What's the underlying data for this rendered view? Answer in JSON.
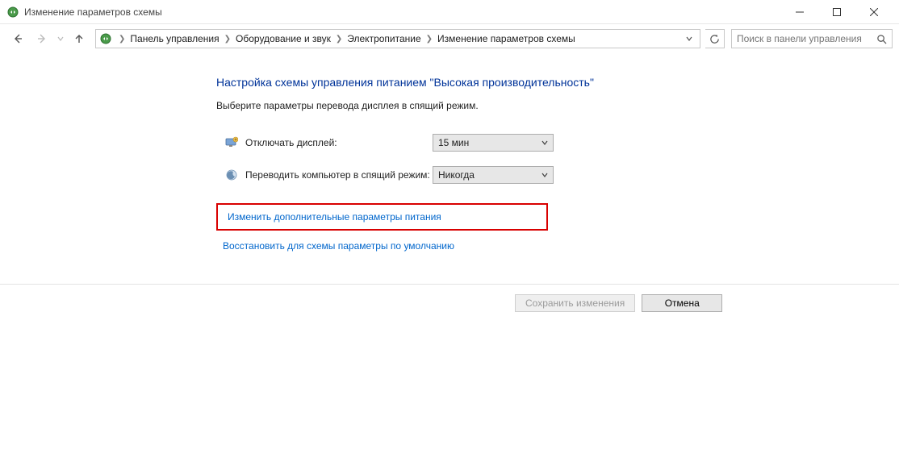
{
  "window": {
    "title": "Изменение параметров схемы"
  },
  "breadcrumb": {
    "items": [
      "Панель управления",
      "Оборудование и звук",
      "Электропитание",
      "Изменение параметров схемы"
    ]
  },
  "search": {
    "placeholder": "Поиск в панели управления"
  },
  "main": {
    "heading": "Настройка схемы управления питанием \"Высокая производительность\"",
    "subheading": "Выберите параметры перевода дисплея в спящий режим.",
    "settings": [
      {
        "label": "Отключать дисплей:",
        "value": "15 мин"
      },
      {
        "label": "Переводить компьютер в спящий режим:",
        "value": "Никогда"
      }
    ],
    "links": {
      "advanced": "Изменить дополнительные параметры питания",
      "restore": "Восстановить для схемы параметры по умолчанию"
    }
  },
  "footer": {
    "save": "Сохранить изменения",
    "cancel": "Отмена"
  }
}
